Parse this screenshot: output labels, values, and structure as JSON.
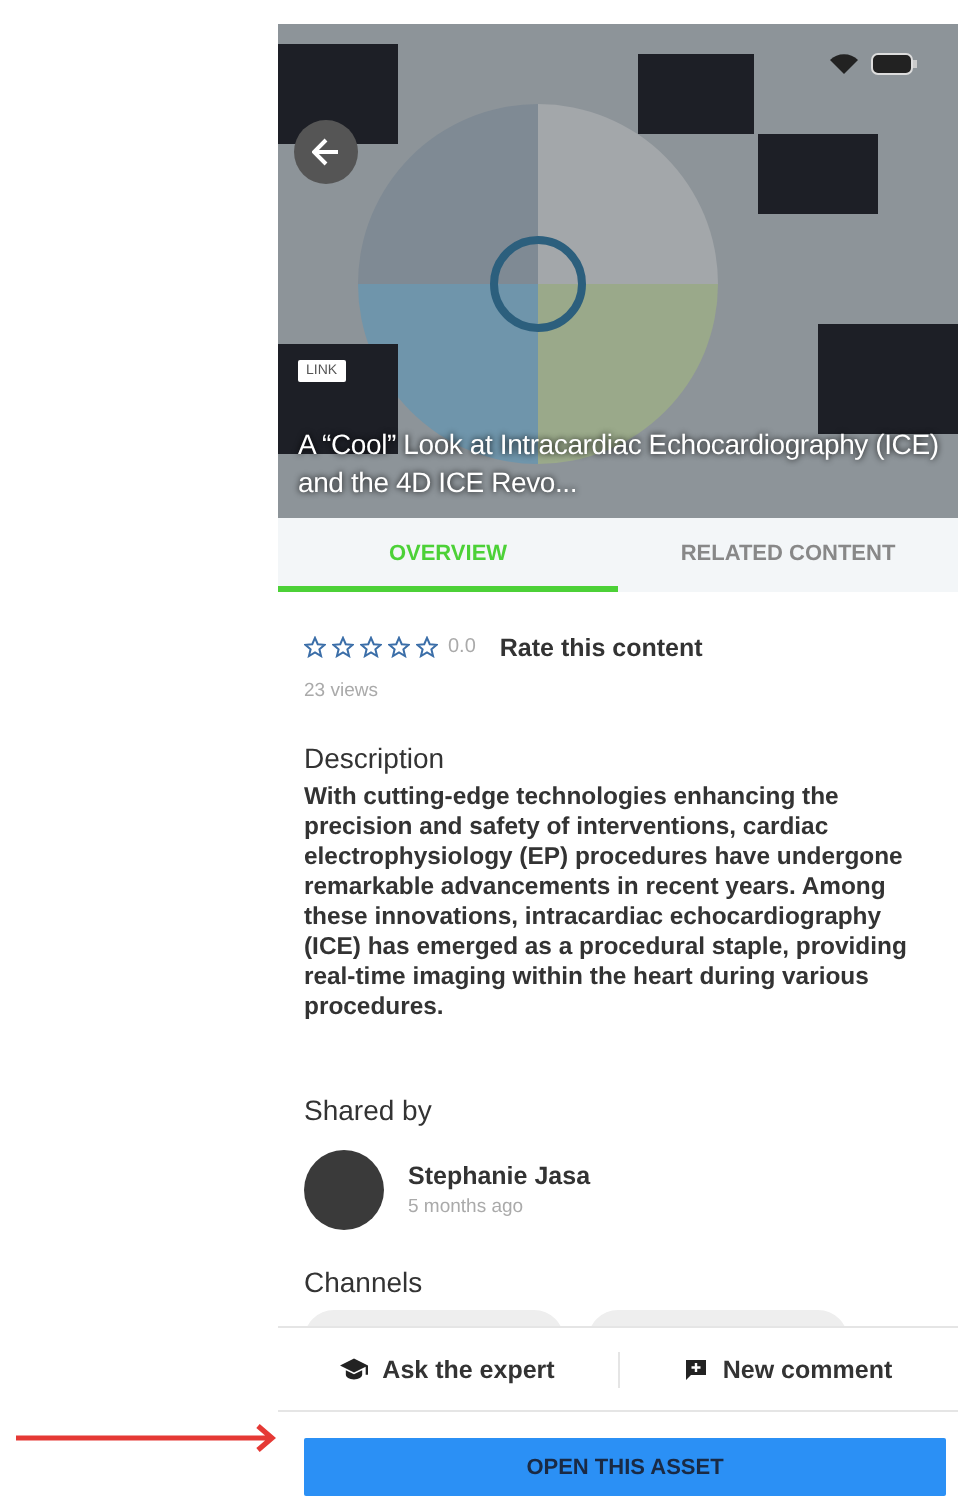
{
  "hero": {
    "badge": "LINK",
    "title": "A “Cool” Look at Intracardiac Echocardiography (ICE) and the 4D ICE Revo..."
  },
  "tabs": [
    {
      "label": "OVERVIEW",
      "selected": true
    },
    {
      "label": "RELATED CONTENT",
      "selected": false
    }
  ],
  "rating": {
    "stars": 0,
    "score": "0.0",
    "action": "Rate this content"
  },
  "views": "23 views",
  "description": {
    "heading": "Description",
    "text": "With cutting-edge technologies enhancing the precision and safety of interventions, cardiac electrophysiology (EP) procedures have undergone remarkable advancements in recent years. Among these innovations, intracardiac echocardiography (ICE) has emerged as a procedural staple, providing real-time imaging within the heart during various procedures."
  },
  "shared_by": {
    "heading": "Shared by",
    "name": "Stephanie Jasa",
    "time": "5 months ago"
  },
  "channels": {
    "heading": "Channels"
  },
  "actions": [
    {
      "label": "Ask the expert",
      "kind": "expert"
    },
    {
      "label": "New comment",
      "kind": "comment"
    }
  ],
  "primary_button": "OPEN THIS ASSET"
}
